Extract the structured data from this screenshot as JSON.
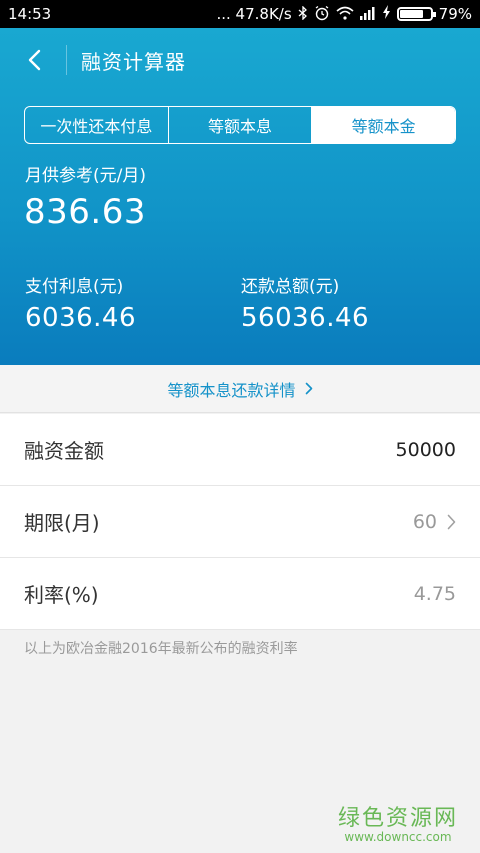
{
  "status_bar": {
    "time": "14:53",
    "network_speed": "... 47.8K/s",
    "battery_percent": "79%",
    "battery_level": 0.79,
    "icons": [
      "bluetooth-icon",
      "alarm-icon",
      "wifi-icon",
      "signal-icon",
      "charging-icon",
      "battery-icon"
    ]
  },
  "header": {
    "title": "融资计算器",
    "tabs": [
      {
        "label": "一次性还本付息",
        "active": false
      },
      {
        "label": "等额本息",
        "active": false
      },
      {
        "label": "等额本金",
        "active": true
      }
    ],
    "monthly_label": "月供参考(元/月)",
    "monthly_value": "836.63",
    "interest_label": "支付利息(元)",
    "interest_value": "6036.46",
    "total_label": "还款总额(元)",
    "total_value": "56036.46"
  },
  "detail_link": {
    "label": "等额本息还款详情"
  },
  "form": {
    "amount_label": "融资金额",
    "amount_value": "50000",
    "term_label": "期限(月)",
    "term_value": "60",
    "rate_label": "利率(%)",
    "rate_value": "4.75"
  },
  "note": "以上为欧冶金融2016年最新公布的融资利率",
  "watermark": {
    "cn": "绿色资源网",
    "en": "www.downcc.com"
  },
  "colors": {
    "primary": "#1592c9",
    "header_top": "#19a8d1",
    "header_bottom": "#0a7cbd",
    "watermark": "#69b856"
  }
}
